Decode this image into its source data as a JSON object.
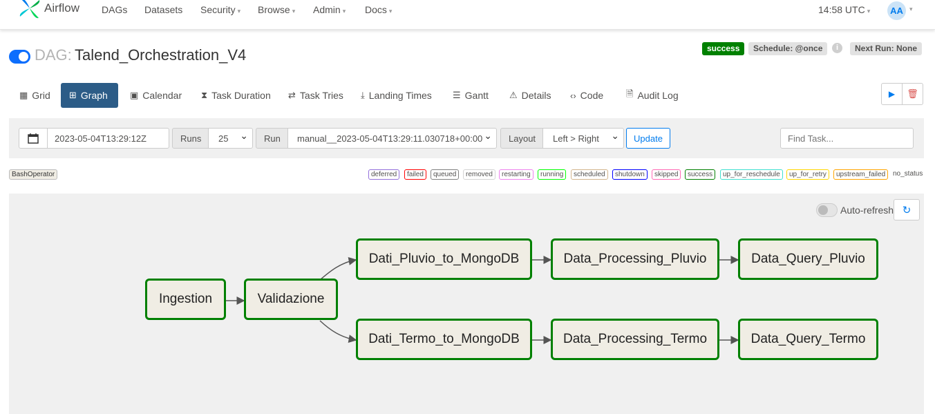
{
  "navbar": {
    "brand": "Airflow",
    "items": [
      {
        "label": "DAGs",
        "dropdown": false
      },
      {
        "label": "Datasets",
        "dropdown": false
      },
      {
        "label": "Security",
        "dropdown": true
      },
      {
        "label": "Browse",
        "dropdown": true
      },
      {
        "label": "Admin",
        "dropdown": true
      },
      {
        "label": "Docs",
        "dropdown": true
      }
    ],
    "clock": "14:58 UTC",
    "user_initials": "AA"
  },
  "dag": {
    "prefix": "DAG:",
    "name": "Talend_Orchestration_V4",
    "status": "success",
    "schedule": "Schedule: @once",
    "next_run": "Next Run: None",
    "paused": false
  },
  "tabs": [
    {
      "label": "Grid",
      "icon": "grid-icon",
      "active": false
    },
    {
      "label": "Graph",
      "icon": "graph-icon",
      "active": true
    },
    {
      "label": "Calendar",
      "icon": "calendar-icon",
      "active": false
    },
    {
      "label": "Task Duration",
      "icon": "hourglass-icon",
      "active": false
    },
    {
      "label": "Task Tries",
      "icon": "retry-icon",
      "active": false
    },
    {
      "label": "Landing Times",
      "icon": "landing-icon",
      "active": false
    },
    {
      "label": "Gantt",
      "icon": "gantt-icon",
      "active": false
    },
    {
      "label": "Details",
      "icon": "warning-icon",
      "active": false
    },
    {
      "label": "Code",
      "icon": "code-icon",
      "active": false
    },
    {
      "label": "Audit Log",
      "icon": "search-doc-icon",
      "active": false
    }
  ],
  "filters": {
    "date": "2023-05-04T13:29:12Z",
    "runs_label": "Runs",
    "runs_value": "25",
    "run_label": "Run",
    "run_value": "manual__2023-05-04T13:29:11.030718+00:00",
    "layout_label": "Layout",
    "layout_value": "Left > Right",
    "update_label": "Update",
    "find_placeholder": "Find Task..."
  },
  "operator_badge": "BashOperator",
  "states": [
    {
      "label": "deferred",
      "color": "#9370db"
    },
    {
      "label": "failed",
      "color": "#ff0000"
    },
    {
      "label": "queued",
      "color": "#808080"
    },
    {
      "label": "removed",
      "color": "#d3d3d3"
    },
    {
      "label": "restarting",
      "color": "#ee82ee"
    },
    {
      "label": "running",
      "color": "#00ff00"
    },
    {
      "label": "scheduled",
      "color": "#d2b48c"
    },
    {
      "label": "shutdown",
      "color": "#0000ff"
    },
    {
      "label": "skipped",
      "color": "#ff69b4"
    },
    {
      "label": "success",
      "color": "#008000"
    },
    {
      "label": "up_for_reschedule",
      "color": "#40e0d0"
    },
    {
      "label": "up_for_retry",
      "color": "#ffd700"
    },
    {
      "label": "upstream_failed",
      "color": "#ffa500"
    }
  ],
  "no_status_label": "no_status",
  "graph": {
    "autorefresh_label": "Auto-refresh",
    "nodes": [
      {
        "id": "ingestion",
        "label": "Ingestion",
        "state": "success"
      },
      {
        "id": "validazione",
        "label": "Validazione",
        "state": "success"
      },
      {
        "id": "dati_pluvio",
        "label": "Dati_Pluvio_to_MongoDB",
        "state": "success"
      },
      {
        "id": "data_processing_pluvio",
        "label": "Data_Processing_Pluvio",
        "state": "success"
      },
      {
        "id": "data_query_pluvio",
        "label": "Data_Query_Pluvio",
        "state": "success"
      },
      {
        "id": "dati_termo",
        "label": "Dati_Termo_to_MongoDB",
        "state": "success"
      },
      {
        "id": "data_processing_termo",
        "label": "Data_Processing_Termo",
        "state": "success"
      },
      {
        "id": "data_query_termo",
        "label": "Data_Query_Termo",
        "state": "success"
      }
    ],
    "edges": [
      [
        "ingestion",
        "validazione"
      ],
      [
        "validazione",
        "dati_pluvio"
      ],
      [
        "validazione",
        "dati_termo"
      ],
      [
        "dati_pluvio",
        "data_processing_pluvio"
      ],
      [
        "data_processing_pluvio",
        "data_query_pluvio"
      ],
      [
        "dati_termo",
        "data_processing_termo"
      ],
      [
        "data_processing_termo",
        "data_query_termo"
      ]
    ]
  }
}
